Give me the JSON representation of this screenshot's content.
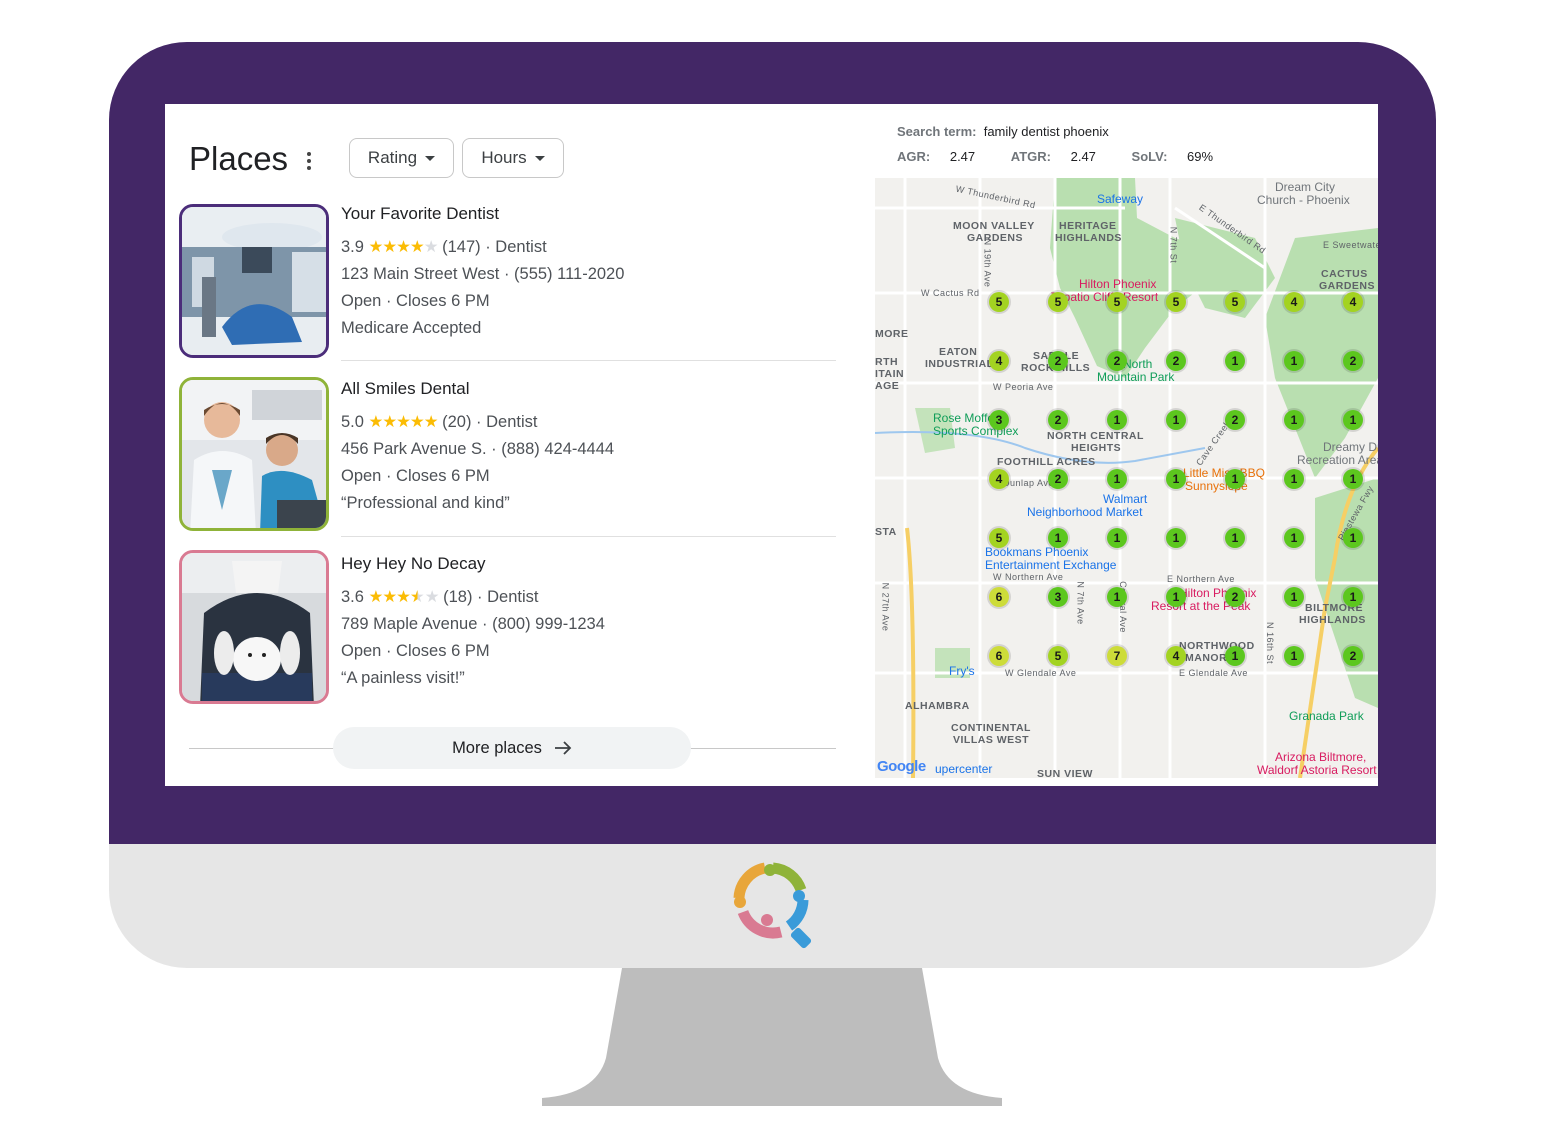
{
  "places": {
    "title": "Places",
    "filters": [
      "Rating",
      "Hours"
    ],
    "listings": [
      {
        "name": "Your Favorite Dentist",
        "rating": "3.9",
        "stars": 4,
        "reviews": "(147)",
        "category": "Dentist",
        "address": "123 Main Street West",
        "phone": "(555) 111-2020",
        "status": "Open",
        "hours": "Closes 6 PM",
        "extra": "Medicare Accepted",
        "border_color": "#4b2d7a"
      },
      {
        "name": "All Smiles Dental",
        "rating": "5.0",
        "stars": 5,
        "reviews": "(20)",
        "category": "Dentist",
        "address": "456 Park Avenue  S.",
        "phone": "(888) 424-4444",
        "status": "Open",
        "hours": "Closes 6 PM",
        "extra": "“Professional and kind”",
        "border_color": "#8fb339"
      },
      {
        "name": "Hey Hey No Decay",
        "rating": "3.6",
        "stars": 3.5,
        "reviews": "(18)",
        "category": "Dentist",
        "address": "789 Maple Avenue",
        "phone": "(800) 999-1234",
        "status": "Open",
        "hours": "Closes 6 PM",
        "extra": "“A painless visit!”",
        "border_color": "#d97a92"
      }
    ],
    "more_label": "More places"
  },
  "search": {
    "term_label": "Search term:",
    "term": "family dentist phoenix",
    "agr_label": "AGR:",
    "agr": "2.47",
    "atgr_label": "ATGR:",
    "atgr": "2.47",
    "solv_label": "SoLV:",
    "solv": "69%"
  },
  "map": {
    "grid_ranks": [
      [
        5,
        5,
        5,
        5,
        5,
        4,
        4
      ],
      [
        4,
        2,
        2,
        2,
        1,
        1,
        2
      ],
      [
        3,
        2,
        1,
        1,
        2,
        1,
        1
      ],
      [
        4,
        2,
        1,
        1,
        1,
        1,
        1
      ],
      [
        5,
        1,
        1,
        1,
        1,
        1,
        1
      ],
      [
        6,
        3,
        1,
        1,
        2,
        1,
        1
      ],
      [
        6,
        5,
        7,
        4,
        1,
        1,
        2
      ]
    ],
    "rank_colors": {
      "top": "#5cc71e",
      "mid": "#a3d321",
      "low": "#cddc39"
    },
    "area_labels": [
      "MOON VALLEY",
      "GARDENS",
      "HERITAGE",
      "HIGHLANDS",
      "CACTUS",
      "GARDENS",
      "EATON",
      "INDUSTRIAL",
      "SADDLE",
      "ROCK HILLS",
      "NORTH CENTRAL",
      "HEIGHTS",
      "FOOTHILL ACRES",
      "BILTMORE",
      "HIGHLANDS",
      "NORTHWOOD",
      "MANOR",
      "ALHAMBRA",
      "CONTINENTAL",
      "VILLAS WEST",
      "SUN VIEW",
      "MORE",
      "RTH",
      "ITAIN",
      "AGE",
      "STA"
    ],
    "street_labels": [
      "W Thunderbird Rd",
      "E Thunderbird Rd",
      "W Cactus Rd",
      "W Peoria Ave",
      "W Northern Ave",
      "E Northern Ave",
      "W Glendale Ave",
      "E Glendale Ave",
      "N 27th Ave",
      "N 19th Ave",
      "N 7th St",
      "N 7th Ave",
      "N 16th St",
      "E Sweetwater",
      "Piestewa Fwy",
      "Cave Creek",
      "Dunlap Ave",
      "Central Ave"
    ],
    "pois": [
      "Safeway",
      "Dream City",
      "Church - Phoenix",
      "Hilton Phoenix",
      "Tapatio Cliffs Resort",
      "North",
      "Mountain Park",
      "Rose Mofford",
      "Sports Complex",
      "Little Miss BBQ",
      "Sunnyslope",
      "Walmart",
      "Neighborhood Market",
      "Dreamy Draw",
      "Recreation Area",
      "Bookmans Phoenix",
      "Entertainment Exchange",
      "Hilton Phoenix",
      "Resort at the Peak",
      "Fry's",
      "Granada Park",
      "Arizona Biltmore,",
      "Waldorf Astoria Resort",
      "upercenter",
      "Google"
    ]
  },
  "icons": {
    "menu": "vertical-dots-icon",
    "caret": "caret-down-icon",
    "arrow": "arrow-right-icon",
    "brand": "search-people-logo-icon"
  }
}
